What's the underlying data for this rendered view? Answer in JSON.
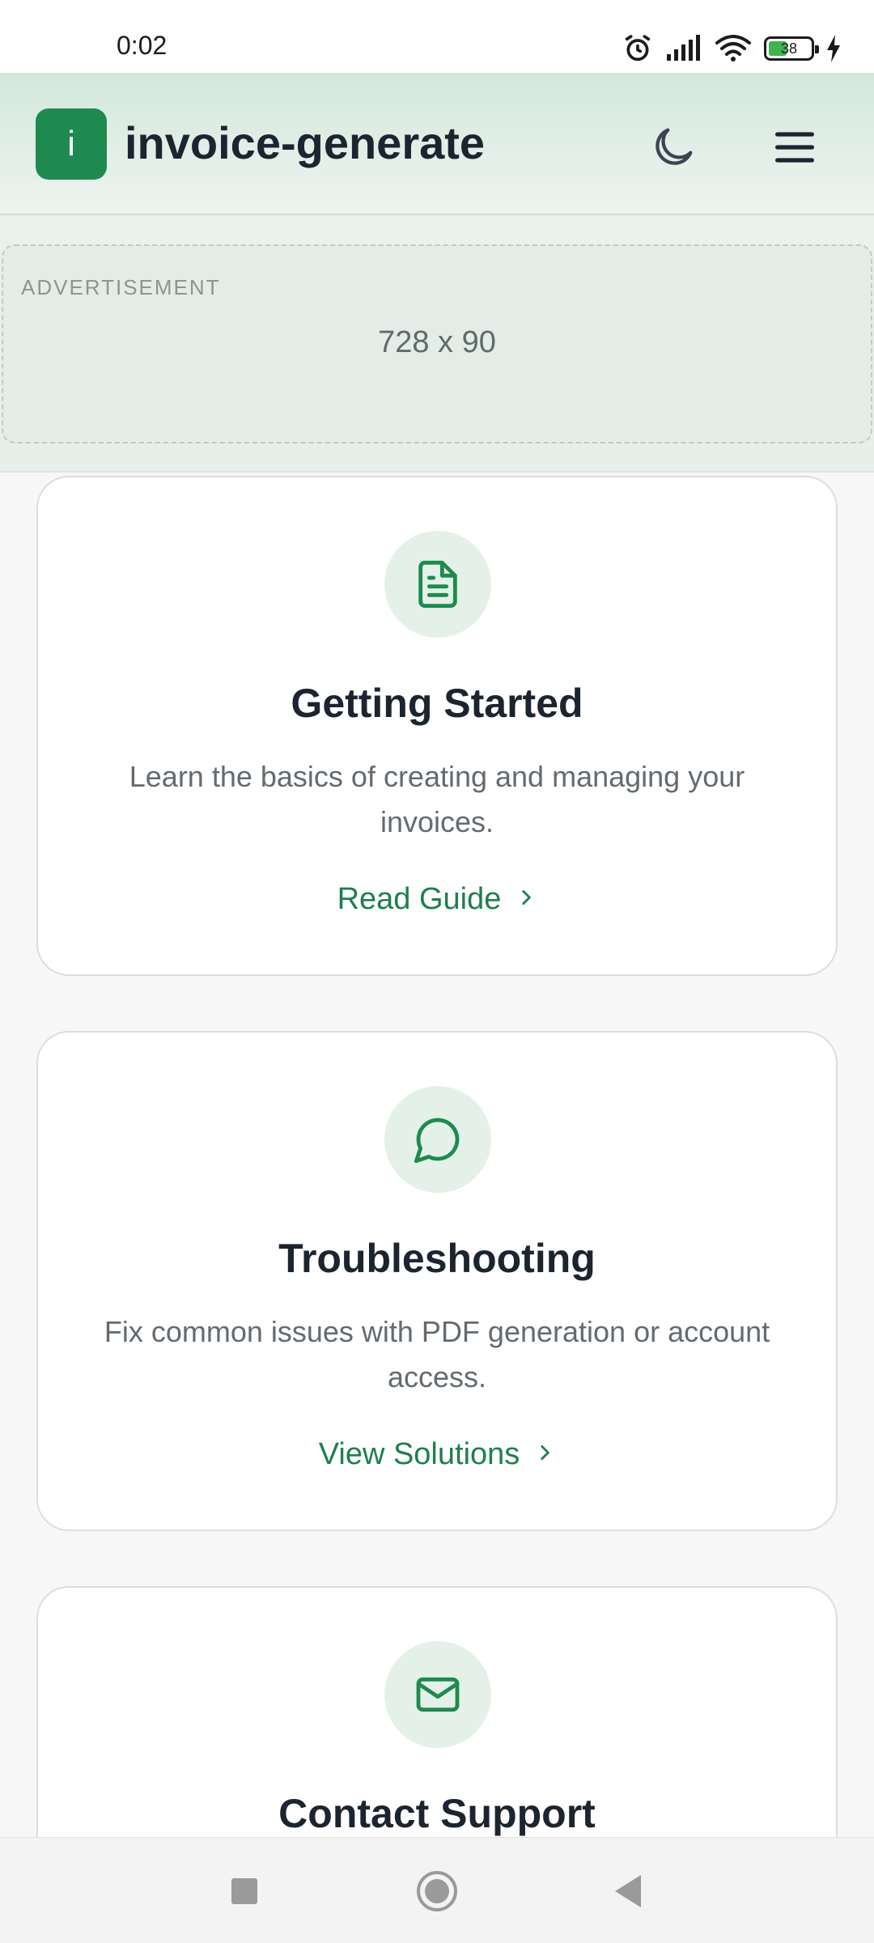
{
  "status_bar": {
    "time": "0:02",
    "battery_level": "38",
    "icons": [
      "alarm-icon",
      "signal-icon",
      "wifi-icon",
      "battery-icon",
      "charging-icon"
    ]
  },
  "header": {
    "logo_letter": "i",
    "brand": "invoice-generate",
    "icons": [
      "moon-icon",
      "hamburger-menu-icon"
    ]
  },
  "ad": {
    "label": "ADVERTISEMENT",
    "size": "728 x 90"
  },
  "cards": [
    {
      "icon": "document-icon",
      "title": "Getting Started",
      "description": "Learn the basics of creating and managing your invoices.",
      "link": "Read Guide"
    },
    {
      "icon": "chat-bubble-icon",
      "title": "Troubleshooting",
      "description": "Fix common issues with PDF generation or account access.",
      "link": "View Solutions"
    },
    {
      "icon": "envelope-icon",
      "title": "Contact Support",
      "description": "",
      "link": ""
    }
  ],
  "colors": {
    "accent": "#1e8a50",
    "link": "#1e7f4e",
    "icon_bg": "#e4f1e8"
  }
}
